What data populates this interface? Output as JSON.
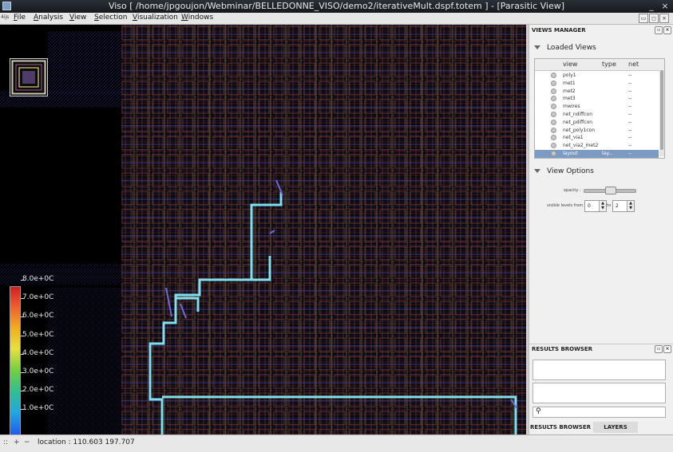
{
  "window": {
    "title": "Viso [ /home/jpgoujon/Webminar/BELLEDONNE_VISO/demo2/iterativeMult.dspf.totem ] - [Parasitic View]",
    "min_label": "_",
    "max_label": "□",
    "close_label": "×"
  },
  "menubar": {
    "tag": "4ijs",
    "items": [
      "File",
      "Analysis",
      "View",
      "Selection",
      "Visualization",
      "Windows"
    ]
  },
  "canvas": {
    "colorbar_labels": [
      "8.0e+0C",
      "7.0e+0C",
      "6.0e+0C",
      "5.0e+0C",
      "4.0e+0C",
      "3.0e+0C",
      "2.0e+0C",
      "1.0e+0C"
    ],
    "colors": {
      "background": "#000000",
      "net_highlight": "#7fe0f0",
      "metal_blue": "#3838a8",
      "metal_red": "#a83030",
      "metal_yellow": "#b0a040"
    }
  },
  "status": {
    "location": "location : 110.603 197.707",
    "icons": [
      "::",
      "+",
      "−"
    ]
  },
  "views_manager": {
    "title": "VIEWS MANAGER",
    "loaded_views_label": "Loaded Views",
    "columns": [
      "view",
      "type",
      "net"
    ],
    "rows": [
      {
        "view": "poly1",
        "type": "",
        "net": "--"
      },
      {
        "view": "met1",
        "type": "",
        "net": "--"
      },
      {
        "view": "met2",
        "type": "",
        "net": "--"
      },
      {
        "view": "met3",
        "type": "",
        "net": "--"
      },
      {
        "view": "mwires",
        "type": "",
        "net": "--"
      },
      {
        "view": "net_ndiffcon",
        "type": "",
        "net": "--"
      },
      {
        "view": "net_pdiffcon",
        "type": "",
        "net": "--"
      },
      {
        "view": "net_poly1con",
        "type": "",
        "net": "--"
      },
      {
        "view": "net_via1",
        "type": "",
        "net": "--"
      },
      {
        "view": "net_via2_met2",
        "type": "",
        "net": "--"
      },
      {
        "view": "layout",
        "type": "lay...",
        "net": "--",
        "selected": true
      }
    ],
    "view_options_label": "View Options",
    "opacity_label": "opacity :",
    "opacity_value": 0.5,
    "visible_levels_label": "visible levels from :",
    "level_from": "0",
    "to_label": "to",
    "level_to": "2"
  },
  "results_browser": {
    "title": "RESULTS BROWSER",
    "search_value": "",
    "tabs": [
      "RESULTS BROWSER",
      "LAYERS"
    ]
  }
}
